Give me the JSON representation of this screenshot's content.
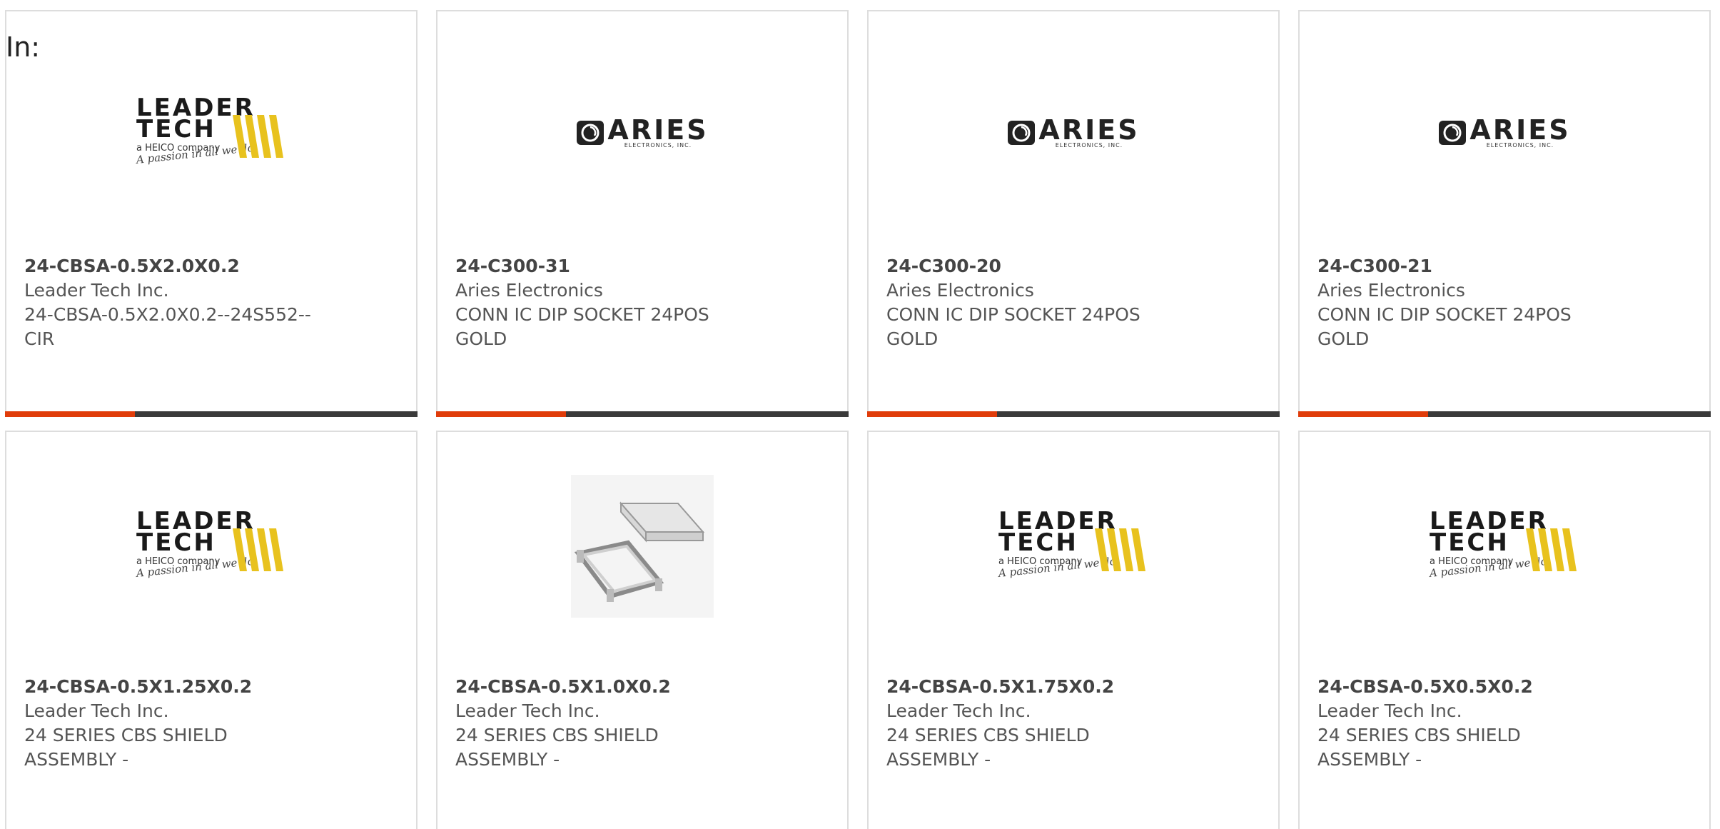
{
  "in_label": "In:",
  "colors": {
    "accent": "#e03c0a",
    "bar": "#3a3a3a",
    "border": "#dddddd",
    "text": "#555555"
  },
  "logos": {
    "leader_tech": {
      "line1": "LEADER",
      "line2": "TECH",
      "sub": "a HEICO company",
      "script": "A passion in all we do"
    },
    "aries": {
      "word": "ARIES",
      "sub": "ELECTRONICS, INC."
    }
  },
  "cards": [
    {
      "part": "24-CBSA-0.5X2.0X0.2",
      "mfr": "Leader Tech Inc.",
      "desc1": "24-CBSA-0.5X2.0X0.2--24S552--",
      "desc2": "CIR",
      "image": "leader-tech-logo"
    },
    {
      "part": "24-C300-31",
      "mfr": "Aries Electronics",
      "desc1": "CONN IC DIP SOCKET 24POS",
      "desc2": "GOLD",
      "image": "aries-logo"
    },
    {
      "part": "24-C300-20",
      "mfr": "Aries Electronics",
      "desc1": "CONN IC DIP SOCKET 24POS",
      "desc2": "GOLD",
      "image": "aries-logo"
    },
    {
      "part": "24-C300-21",
      "mfr": "Aries Electronics",
      "desc1": "CONN IC DIP SOCKET 24POS",
      "desc2": "GOLD",
      "image": "aries-logo"
    },
    {
      "part": "24-CBSA-0.5X1.25X0.2",
      "mfr": "Leader Tech Inc.",
      "desc1": "24 SERIES CBS SHIELD",
      "desc2": "ASSEMBLY -",
      "image": "leader-tech-logo"
    },
    {
      "part": "24-CBSA-0.5X1.0X0.2",
      "mfr": "Leader Tech Inc.",
      "desc1": "24 SERIES CBS SHIELD",
      "desc2": "ASSEMBLY -",
      "image": "shield-photo"
    },
    {
      "part": "24-CBSA-0.5X1.75X0.2",
      "mfr": "Leader Tech Inc.",
      "desc1": "24 SERIES CBS SHIELD",
      "desc2": "ASSEMBLY -",
      "image": "leader-tech-logo"
    },
    {
      "part": "24-CBSA-0.5X0.5X0.2",
      "mfr": "Leader Tech Inc.",
      "desc1": "24 SERIES CBS SHIELD",
      "desc2": "ASSEMBLY -",
      "image": "leader-tech-logo"
    }
  ]
}
